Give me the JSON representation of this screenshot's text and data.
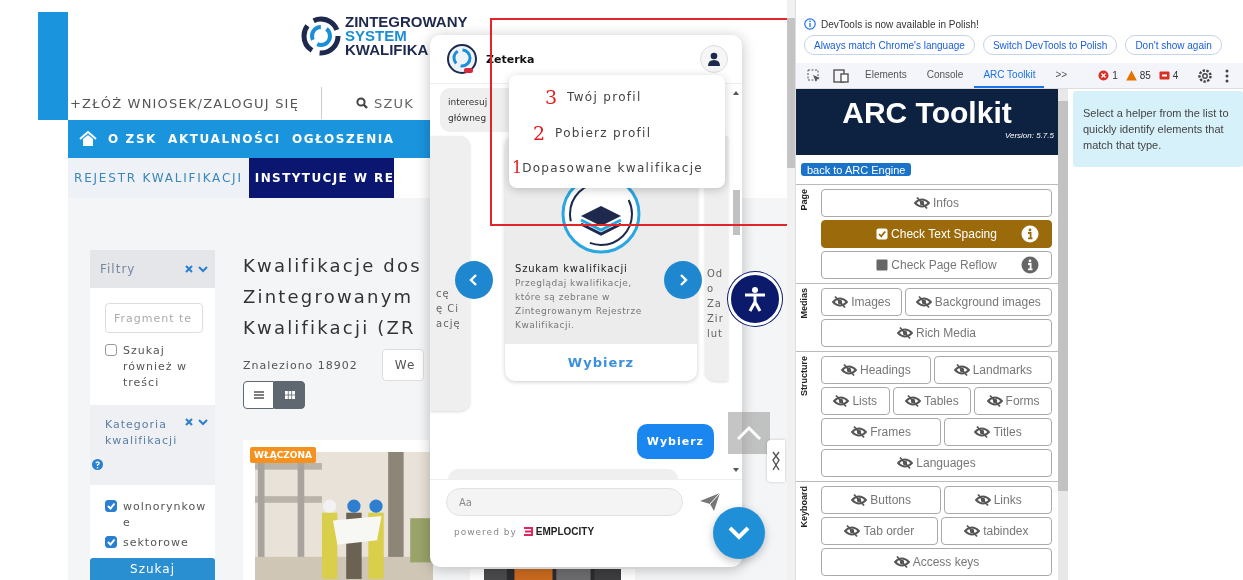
{
  "site": {
    "logo_lines": [
      "ZINTEGROWANY",
      "SYSTEM",
      "KWALIFIKA"
    ],
    "apply_link": "+ZŁÓŻ WNIOSEK/ZALOGUJ SIĘ",
    "search_link": "SZUK",
    "main_nav": [
      "O ZSK",
      "AKTUALNOŚCI",
      "OGŁOSZENIA"
    ],
    "sub_nav": [
      {
        "label": "REJESTR KWALIFIKACJI",
        "selected": false
      },
      {
        "label": "INSTYTUCJE W RE",
        "selected": true
      }
    ],
    "filters": {
      "title": "Filtry",
      "search_placeholder": "Fragment te",
      "search_in_content": {
        "label": "Szukaj również w treści",
        "checked": false
      },
      "category": {
        "title": "Kategoria kwalifikacji",
        "options": [
          {
            "label": "wolnorynkowe",
            "checked": true
          },
          {
            "label": "sektorowe",
            "checked": true
          }
        ]
      },
      "submit": "Szukaj"
    },
    "results": {
      "heading_lines": [
        "Kwalifikacje dos",
        "Zintegrowanym",
        "Kwalifikacji (ZR"
      ],
      "count": "Znaleziono 18902",
      "sort": "We",
      "views": [
        {
          "kind": "list",
          "selected": false
        },
        {
          "kind": "grid",
          "selected": true
        }
      ],
      "cards": [
        {
          "kind": "picture",
          "badge": "WŁĄCZONA"
        },
        {
          "kind": "picture"
        }
      ]
    }
  },
  "chat": {
    "title": "Zeterka",
    "menu": [
      {
        "label": "Twój profil",
        "marker": "3"
      },
      {
        "label": "Pobierz profil",
        "marker": "2"
      },
      {
        "label": "Dopasowane kwalifikacje",
        "marker": "1"
      }
    ],
    "bot_message_lines": [
      "interesuj",
      "główneg"
    ],
    "carousel": [
      {
        "kind": "partial-left",
        "lines": [
          "cę",
          "ę Ci",
          "ację"
        ]
      },
      {
        "kind": "full",
        "title": "Szukam kwalifikacji",
        "text": "Przeglądaj kwalifikacje, które są zebrane w Zintegrowanym Rejestrze Kwalifikacji.",
        "action": "Wybierz"
      },
      {
        "kind": "partial-right",
        "lines": [
          "Od",
          "o",
          "Za",
          "Zir",
          "lut"
        ]
      }
    ],
    "user_message": "Wybierz",
    "input_placeholder": "Aa",
    "powered_by": "powered by",
    "brand": "EMPLOCITY"
  },
  "devtools": {
    "notice": "DevTools is now available in Polish!",
    "notice_buttons": [
      "Always match Chrome's language",
      "Switch DevTools to Polish",
      "Don't show again"
    ],
    "tabs": [
      {
        "label": "Elements",
        "selected": false
      },
      {
        "label": "Console",
        "selected": false
      },
      {
        "label": "ARC Toolkit",
        "selected": true
      }
    ],
    "more_tabs": ">>",
    "counters": [
      {
        "kind": "error",
        "count": "1"
      },
      {
        "kind": "warning",
        "count": "85"
      },
      {
        "kind": "issue",
        "count": "4"
      }
    ],
    "arc": {
      "title": "ARC Toolkit",
      "version": "Version: 5.7.5",
      "back_button": "back to ARC Engine",
      "sections": [
        {
          "label": "Page",
          "groups": [
            {
              "buttons": [
                {
                  "label": "Infos",
                  "kind": "helper"
                }
              ]
            },
            {
              "buttons": [
                {
                  "label": "Check Text Spacing",
                  "kind": "check",
                  "checked": true
                }
              ]
            },
            {
              "buttons": [
                {
                  "label": "Check Page Reflow",
                  "kind": "check",
                  "checked": false
                }
              ]
            }
          ]
        },
        {
          "label": "Medias",
          "groups": [
            {
              "buttons": [
                {
                  "label": "Images",
                  "kind": "helper"
                },
                {
                  "label": "Background images",
                  "kind": "helper"
                }
              ]
            },
            {
              "buttons": [
                {
                  "label": "Rich Media",
                  "kind": "helper"
                }
              ]
            }
          ]
        },
        {
          "label": "Structure",
          "groups": [
            {
              "buttons": [
                {
                  "label": "Headings",
                  "kind": "helper"
                },
                {
                  "label": "Landmarks",
                  "kind": "helper"
                }
              ]
            },
            {
              "buttons": [
                {
                  "label": "Lists",
                  "kind": "helper"
                },
                {
                  "label": "Tables",
                  "kind": "helper"
                },
                {
                  "label": "Forms",
                  "kind": "helper"
                }
              ]
            },
            {
              "buttons": [
                {
                  "label": "Frames",
                  "kind": "helper"
                },
                {
                  "label": "Titles",
                  "kind": "helper"
                }
              ]
            },
            {
              "buttons": [
                {
                  "label": "Languages",
                  "kind": "helper"
                }
              ]
            }
          ]
        },
        {
          "label": "Keyboard",
          "groups": [
            {
              "buttons": [
                {
                  "label": "Buttons",
                  "kind": "helper"
                },
                {
                  "label": "Links",
                  "kind": "helper"
                }
              ]
            },
            {
              "buttons": [
                {
                  "label": "Tab order",
                  "kind": "helper"
                },
                {
                  "label": "tabindex",
                  "kind": "helper"
                }
              ]
            },
            {
              "buttons": [
                {
                  "label": "Access keys",
                  "kind": "helper"
                }
              ]
            }
          ]
        }
      ]
    },
    "info": "Select a helper from the list to quickly identify elements that match that type."
  }
}
